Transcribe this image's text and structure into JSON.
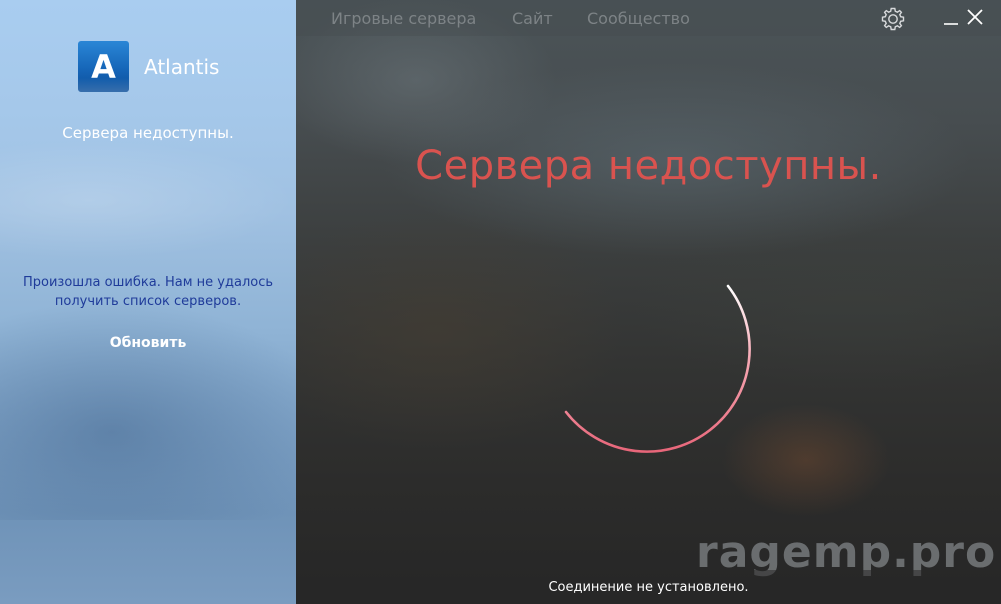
{
  "app": {
    "name": "Atlantis",
    "logo_letter": "A"
  },
  "sidebar": {
    "status": "Сервера недоступны.",
    "error_message": "Произошла ошибка. Нам не удалось получить список серверов.",
    "refresh_label": "Обновить"
  },
  "nav": {
    "items": [
      {
        "label": "Игровые сервера"
      },
      {
        "label": "Сайт"
      },
      {
        "label": "Сообщество"
      }
    ]
  },
  "window_controls": {
    "settings_icon": "gear-icon",
    "minimize_icon": "minimize-icon",
    "close_icon": "close-icon"
  },
  "main": {
    "headline": "Сервера недоступны.",
    "spinner_icon": "loading-spinner",
    "watermark": "ragemp.pro"
  },
  "status_bar": {
    "text": "Соединение не установлено."
  },
  "colors": {
    "headline": "#d9534f",
    "spinner": "#e8667a",
    "error_text": "#1f3b9a",
    "logo_bg": "#1666b8"
  }
}
